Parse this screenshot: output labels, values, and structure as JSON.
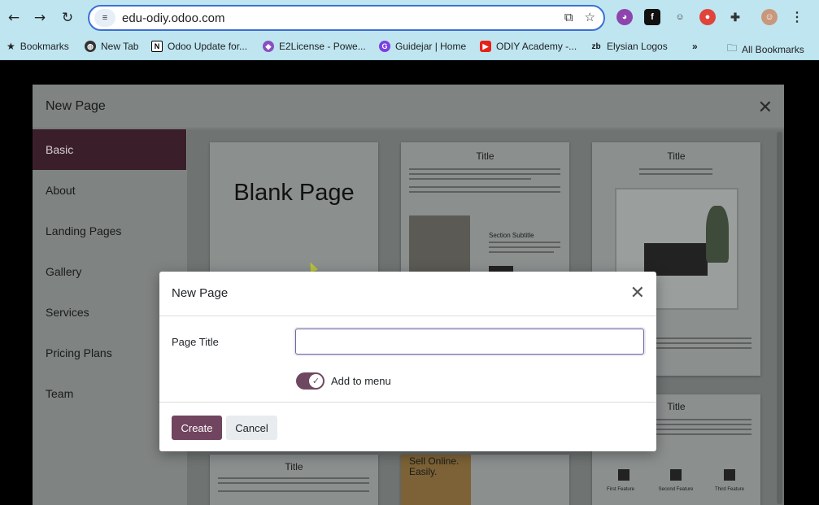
{
  "browser": {
    "url": "edu-odiy.odoo.com",
    "back_icon": "arrow-left-icon",
    "forward_icon": "arrow-right-icon",
    "reload_icon": "reload-icon"
  },
  "bookmarks": [
    {
      "label": "Bookmarks",
      "icon": "star-icon"
    },
    {
      "label": "New Tab",
      "icon": "globe-icon"
    },
    {
      "label": "Odoo Update for...",
      "icon": "notion-icon"
    },
    {
      "label": "E2License - Powe...",
      "icon": "diamond-icon"
    },
    {
      "label": "Guidejar | Home",
      "icon": "guidejar-icon"
    },
    {
      "label": "ODIY Academy -...",
      "icon": "youtube-icon"
    },
    {
      "label": "Elysian Logos",
      "icon": "zb-icon"
    },
    {
      "label": "»",
      "icon": "more-icon"
    },
    {
      "label": "All Bookmarks",
      "icon": "folder-icon"
    }
  ],
  "outer_dialog": {
    "title": "New Page",
    "sidebar": [
      "Basic",
      "About",
      "Landing Pages",
      "Gallery",
      "Services",
      "Pricing Plans",
      "Team"
    ],
    "active_item": "Basic",
    "templates": {
      "blank": "Blank Page",
      "title": "Title",
      "section_subtitle": "Section Subtitle",
      "sell_online": "Sell Online. Easily.",
      "features": [
        "First Feature",
        "Second Feature",
        "Third Feature"
      ]
    }
  },
  "modal": {
    "title": "New Page",
    "field_label": "Page Title",
    "input_value": "",
    "input_placeholder": "",
    "toggle_label": "Add to menu",
    "toggle_on": true,
    "create_label": "Create",
    "cancel_label": "Cancel"
  },
  "colors": {
    "primary": "#71445f",
    "sidebar_active": "#3a1f2a",
    "focus_border": "#71639e",
    "browser_chrome": "#bfe6f0"
  }
}
